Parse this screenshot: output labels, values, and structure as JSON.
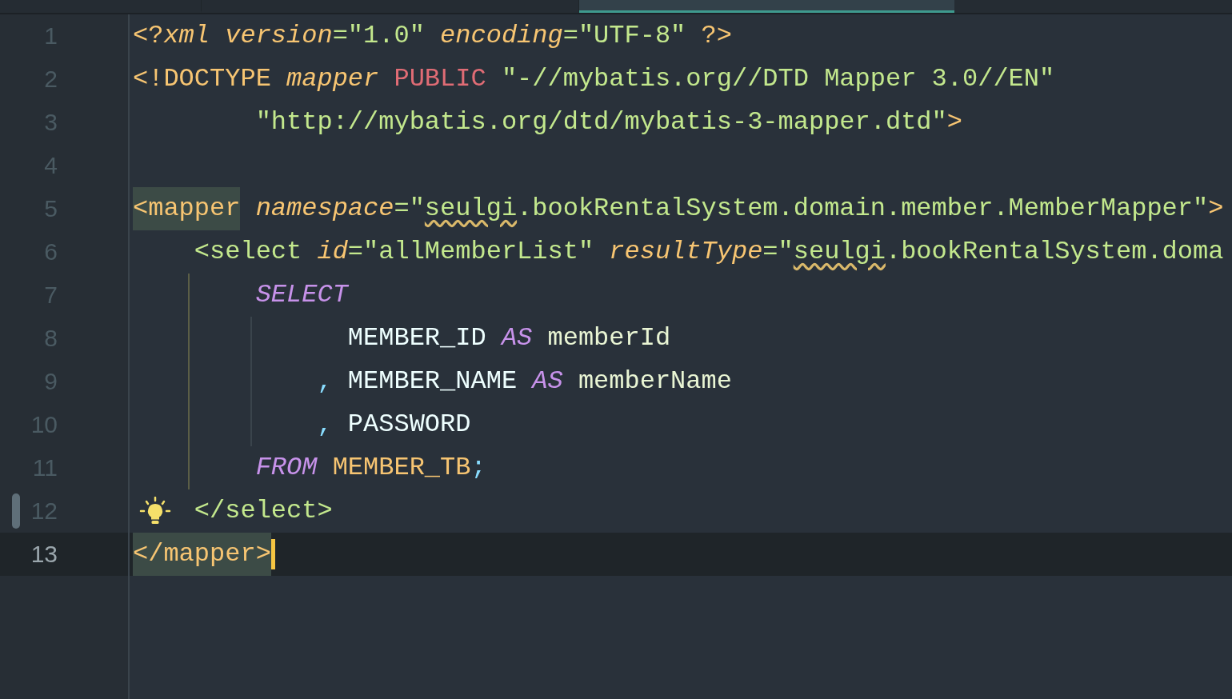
{
  "tabs": [
    {
      "selected": false
    },
    {
      "selected": false
    },
    {
      "selected": true
    }
  ],
  "lines": [
    {
      "number": "1",
      "current": false,
      "bulb": false,
      "changed": false,
      "tokens": [
        {
          "text": "<?",
          "kind": "tag"
        },
        {
          "text": "xml",
          "kind": "attr"
        },
        {
          "text": " version",
          "kind": "attr"
        },
        {
          "text": "=",
          "kind": "eq"
        },
        {
          "text": "\"1.0\"",
          "kind": "string"
        },
        {
          "text": " encoding",
          "kind": "attr"
        },
        {
          "text": "=",
          "kind": "eq"
        },
        {
          "text": "\"UTF-8\"",
          "kind": "string"
        },
        {
          "text": " ?>",
          "kind": "tag"
        }
      ]
    },
    {
      "number": "2",
      "current": false,
      "bulb": false,
      "changed": false,
      "tokens": [
        {
          "text": "<!DOCTYPE",
          "kind": "tag"
        },
        {
          "text": " mapper",
          "kind": "attr"
        },
        {
          "text": " PUBLIC",
          "kind": "doctype"
        },
        {
          "text": " \"-//mybatis.org//DTD Mapper 3.0//EN\"",
          "kind": "string"
        }
      ]
    },
    {
      "number": "3",
      "current": false,
      "bulb": false,
      "changed": false,
      "tokens": [
        {
          "text": "        \"http://mybatis.org/dtd/mybatis-3-mapper.dtd\"",
          "kind": "string"
        },
        {
          "text": ">",
          "kind": "tag"
        }
      ]
    },
    {
      "number": "4",
      "current": false,
      "bulb": false,
      "changed": false
    },
    {
      "number": "5",
      "current": false,
      "bulb": false,
      "changed": false,
      "tokens": [
        {
          "text": "<mapper",
          "kind": "tag",
          "highlighted": true
        },
        {
          "text": " namespace",
          "kind": "attr"
        },
        {
          "text": "=\"",
          "kind": "eq"
        },
        {
          "text": "seulgi",
          "kind": "string",
          "misspelled": true
        },
        {
          "text": ".bookRentalSystem.domain.member.MemberMapper\"",
          "kind": "string"
        },
        {
          "text": ">",
          "kind": "tag"
        }
      ]
    },
    {
      "number": "6",
      "current": false,
      "bulb": false,
      "changed": false,
      "tokens": [
        {
          "text": "    <select",
          "kind": "xtag"
        },
        {
          "text": " id",
          "kind": "attr"
        },
        {
          "text": "=\"allMemberList\"",
          "kind": "string"
        },
        {
          "text": " resultType",
          "kind": "attr"
        },
        {
          "text": "=\"",
          "kind": "eq"
        },
        {
          "text": "seulgi",
          "kind": "string",
          "misspelled": true
        },
        {
          "text": ".bookRentalSystem.doma",
          "kind": "string"
        }
      ]
    },
    {
      "number": "7",
      "current": false,
      "bulb": false,
      "changed": false,
      "tokens": [
        {
          "text": "        SELECT",
          "kind": "keyword"
        }
      ]
    },
    {
      "number": "8",
      "current": false,
      "bulb": false,
      "changed": false,
      "tokens": [
        {
          "text": "              MEMBER_ID",
          "kind": "column"
        },
        {
          "text": " AS",
          "kind": "keyword"
        },
        {
          "text": " memberId",
          "kind": "alias"
        }
      ]
    },
    {
      "number": "9",
      "current": false,
      "bulb": false,
      "changed": false,
      "tokens": [
        {
          "text": "            ,",
          "kind": "punct"
        },
        {
          "text": " MEMBER_NAME",
          "kind": "column"
        },
        {
          "text": " AS",
          "kind": "keyword"
        },
        {
          "text": " memberName",
          "kind": "alias"
        }
      ]
    },
    {
      "number": "10",
      "current": false,
      "bulb": false,
      "changed": false,
      "tokens": [
        {
          "text": "            ,",
          "kind": "punct"
        },
        {
          "text": " PASSWORD",
          "kind": "column"
        }
      ]
    },
    {
      "number": "11",
      "current": false,
      "bulb": false,
      "changed": false,
      "tokens": [
        {
          "text": "        FROM",
          "kind": "keyword"
        },
        {
          "text": " MEMBER_TB",
          "kind": "table"
        },
        {
          "text": ";",
          "kind": "punct"
        }
      ]
    },
    {
      "number": "12",
      "current": false,
      "bulb": true,
      "changed": true,
      "tokens": [
        {
          "text": "    </select>",
          "kind": "xtag"
        }
      ]
    },
    {
      "number": "13",
      "current": true,
      "bulb": false,
      "changed": false,
      "tokens": [
        {
          "text": "</mapper>",
          "kind": "tag",
          "highlighted": true
        }
      ]
    }
  ]
}
